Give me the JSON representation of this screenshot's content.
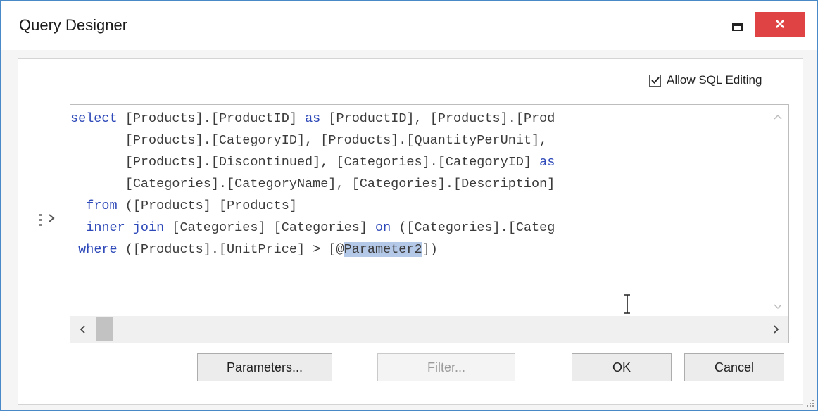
{
  "window": {
    "title": "Query Designer",
    "close_label": "×"
  },
  "options": {
    "allow_sql_editing_label": "Allow SQL Editing",
    "allow_sql_editing_checked": true
  },
  "editor": {
    "lines": [
      [
        [
          "kw",
          "select"
        ],
        [
          "t",
          " [Products].[ProductID] "
        ],
        [
          "kw",
          "as"
        ],
        [
          "t",
          " [ProductID], [Products].[Prod"
        ]
      ],
      [
        [
          "t",
          "       [Products].[CategoryID], [Products].[QuantityPerUnit],"
        ]
      ],
      [
        [
          "t",
          "       [Products].[Discontinued], [Categories].[CategoryID] "
        ],
        [
          "kw",
          "as"
        ]
      ],
      [
        [
          "t",
          "       [Categories].[CategoryName], [Categories].[Description]"
        ]
      ],
      [
        [
          "t",
          "  "
        ],
        [
          "kw",
          "from"
        ],
        [
          "t",
          " ([Products] [Products]"
        ]
      ],
      [
        [
          "t",
          "  "
        ],
        [
          "kw",
          "inner join"
        ],
        [
          "t",
          " [Categories] [Categories] "
        ],
        [
          "kw",
          "on"
        ],
        [
          "t",
          " ([Categories].[Categ"
        ]
      ],
      [
        [
          "t",
          " "
        ],
        [
          "kw",
          "where"
        ],
        [
          "t",
          " ([Products].[UnitPrice] > [@"
        ],
        [
          "sel",
          "Parameter2"
        ],
        [
          "t",
          "])"
        ]
      ]
    ]
  },
  "buttons": {
    "parameters": "Parameters...",
    "filter": "Filter...",
    "ok": "OK",
    "cancel": "Cancel"
  },
  "colors": {
    "keyword": "#2d48b8",
    "selection": "#b4c8e8",
    "close_button": "#e04343",
    "window_border": "#4a89c8"
  }
}
